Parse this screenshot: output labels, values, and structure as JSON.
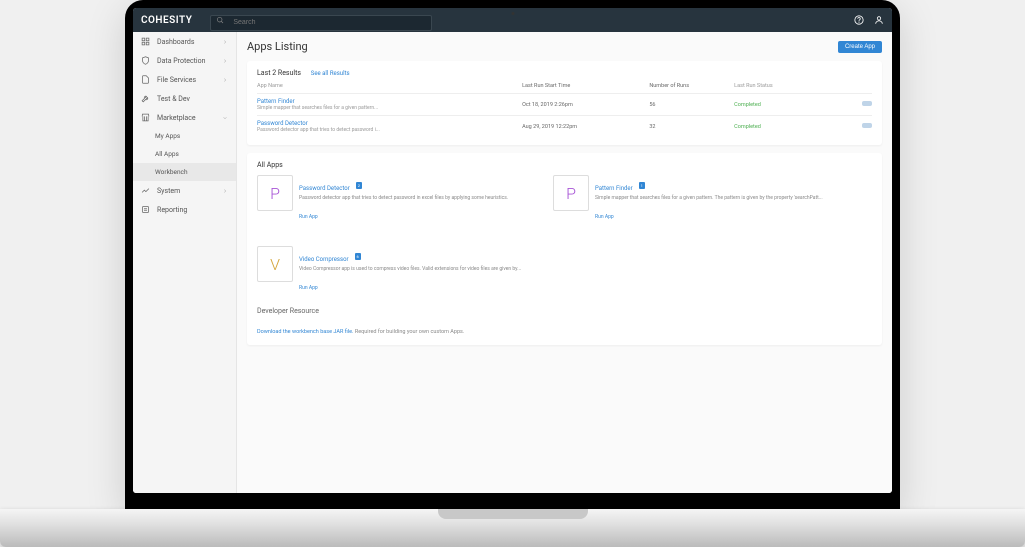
{
  "brand": "COHESITY",
  "search": {
    "placeholder": "Search"
  },
  "sidebar": {
    "items": [
      {
        "label": "Dashboards",
        "icon": "grid",
        "chev": true
      },
      {
        "label": "Data Protection",
        "icon": "shield",
        "chev": true
      },
      {
        "label": "File Services",
        "icon": "folder",
        "chev": true
      },
      {
        "label": "Test & Dev",
        "icon": "wrench",
        "chev": false
      },
      {
        "label": "Marketplace",
        "icon": "store",
        "chev": true,
        "expanded": true
      },
      {
        "label": "My Apps",
        "sub": true
      },
      {
        "label": "All Apps",
        "sub": true
      },
      {
        "label": "Workbench",
        "sub": true,
        "active": true
      },
      {
        "label": "System",
        "icon": "trend",
        "chev": true
      },
      {
        "label": "Reporting",
        "icon": "report",
        "chev": false
      }
    ]
  },
  "page": {
    "title": "Apps Listing",
    "create": "Create App"
  },
  "results": {
    "headerPrefix": "Last 2 Results",
    "seeAll": "See all Results",
    "cols": [
      "App Name",
      "Last Run Start Time",
      "Number of Runs",
      "Last Run Status"
    ],
    "rows": [
      {
        "name": "Pattern Finder",
        "desc": "Simple mapper that searches files for a given pattern...",
        "time": "Oct 18, 2019 2:26pm",
        "runs": "56",
        "status": "Completed"
      },
      {
        "name": "Password Detector",
        "desc": "Password detector app that tries to detect password i...",
        "time": "Aug 29, 2019 12:22pm",
        "runs": "32",
        "status": "Completed"
      }
    ]
  },
  "allApps": {
    "title": "All Apps",
    "apps": [
      {
        "letter": "P",
        "cls": "badge-P",
        "name": "Password Detector",
        "tag": "2",
        "desc": "Password detector app that tries to detect password in excel files by applying some heuristics.",
        "run": "Run App"
      },
      {
        "letter": "P",
        "cls": "badge-P",
        "name": "Pattern Finder",
        "tag": "1",
        "desc": "Simple mapper that searches files for a given pattern. The pattern is given by the property 'searchPatt...",
        "run": "Run App"
      },
      {
        "letter": "V",
        "cls": "badge-V",
        "name": "Video Compressor",
        "tag": "6",
        "desc": "Video Compressor app is used to compress video files. Valid extensions for video files are given by...",
        "run": "Run App"
      }
    ]
  },
  "dev": {
    "title": "Developer Resource",
    "link": "Download the workbench base JAR file.",
    "text": " Required for building your own custom Apps."
  }
}
